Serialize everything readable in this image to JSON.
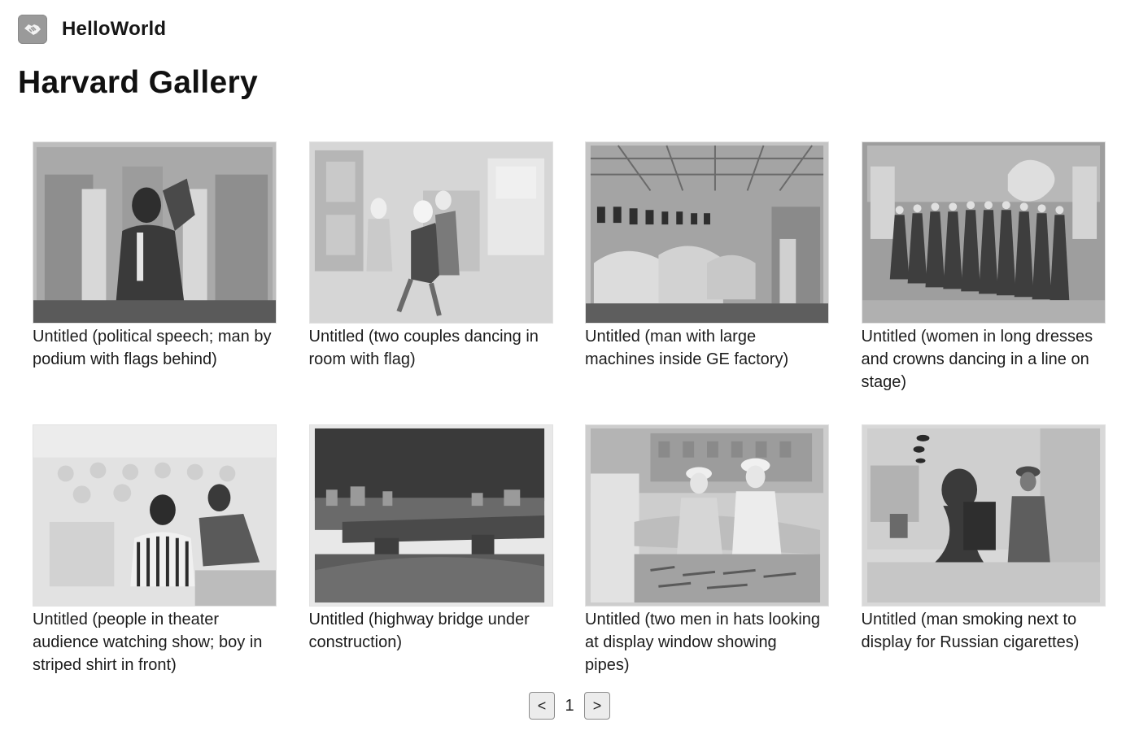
{
  "app": {
    "name": "HelloWorld",
    "logo_icon": "handshake-icon"
  },
  "page": {
    "title": "Harvard Gallery"
  },
  "gallery": {
    "items": [
      {
        "caption": "Untitled (political speech; man by podium with flags behind)"
      },
      {
        "caption": "Untitled (two couples dancing in room with flag)"
      },
      {
        "caption": "Untitled (man with large machines inside GE factory)"
      },
      {
        "caption": "Untitled (women in long dresses and crowns dancing in a line on stage)"
      },
      {
        "caption": "Untitled (people in theater audience watching show; boy in striped shirt in front)"
      },
      {
        "caption": "Untitled (highway bridge under construction)"
      },
      {
        "caption": "Untitled (two men in hats looking at display window showing pipes)"
      },
      {
        "caption": "Untitled (man smoking next to display for Russian cigarettes)"
      }
    ]
  },
  "pagination": {
    "prev_label": "<",
    "current_page": "1",
    "next_label": ">"
  }
}
